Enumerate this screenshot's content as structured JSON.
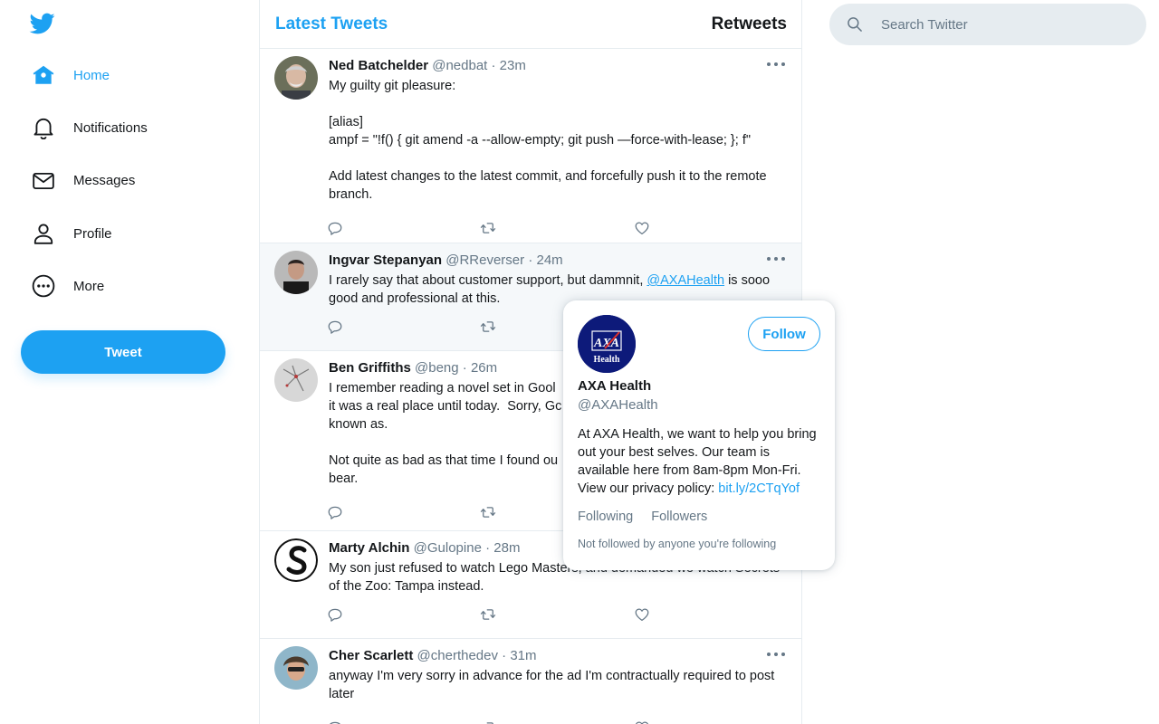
{
  "sidebar": {
    "items": [
      {
        "label": "Home",
        "icon": "home-icon",
        "active": true
      },
      {
        "label": "Notifications",
        "icon": "bell-icon"
      },
      {
        "label": "Messages",
        "icon": "envelope-icon"
      },
      {
        "label": "Profile",
        "icon": "person-icon"
      },
      {
        "label": "More",
        "icon": "more-circle-icon"
      }
    ],
    "tweet_button": "Tweet"
  },
  "header": {
    "latest_tab": "Latest Tweets",
    "retweets_tab": "Retweets"
  },
  "search": {
    "placeholder": "Search Twitter"
  },
  "tweets": [
    {
      "name": "Ned Batchelder",
      "handle": "@nedbat",
      "sep": "·",
      "time": "23m",
      "text": "My guilty git pleasure:\n\n[alias]\nampf = \"!f() { git amend -a --allow-empty; git push —force-with-lease; }; f\"\n\nAdd latest changes to the latest commit, and forcefully push it to the remote branch."
    },
    {
      "name": "Ingvar Stepanyan",
      "handle": "@RReverser",
      "sep": "·",
      "time": "24m",
      "text_before": "I rarely say that about customer support, but dammnit, ",
      "mention": "@AXAHealth",
      "text_after": " is sooo good and professional at this."
    },
    {
      "name": "Ben Griffiths",
      "handle": "@beng",
      "sep": "·",
      "time": "26m",
      "text": "I remember reading a novel set in Gool\nit was a real place until today.  Sorry, Gc\nknown as.\n\nNot quite as bad as that time I found ou\nbear."
    },
    {
      "name": "Marty Alchin",
      "handle": "@Gulopine",
      "sep": "·",
      "time": "28m",
      "text": "My son just refused to watch Lego Masters, and demanded we watch Secrets of the Zoo: Tampa instead."
    },
    {
      "name": "Cher Scarlett",
      "handle": "@cherthedev",
      "sep": "·",
      "time": "31m",
      "text": "anyway I'm very sorry in advance for the ad I'm contractually required to post later"
    }
  ],
  "hovercard": {
    "name": "AXA Health",
    "handle": "@AXAHealth",
    "follow_label": "Follow",
    "bio": "At AXA Health, we want to help you bring out your best selves. Our team is available here from 8am-8pm Mon-Fri. View our privacy policy: ",
    "bio_link": "bit.ly/2CTqYof",
    "following_label": "Following",
    "followers_label": "Followers",
    "note": "Not followed by anyone you're following",
    "logo_text": "AXA",
    "logo_subtext": "Health"
  },
  "colors": {
    "accent": "#1da1f2",
    "text": "#14171a",
    "muted": "#657786",
    "border": "#e6ecf0"
  }
}
